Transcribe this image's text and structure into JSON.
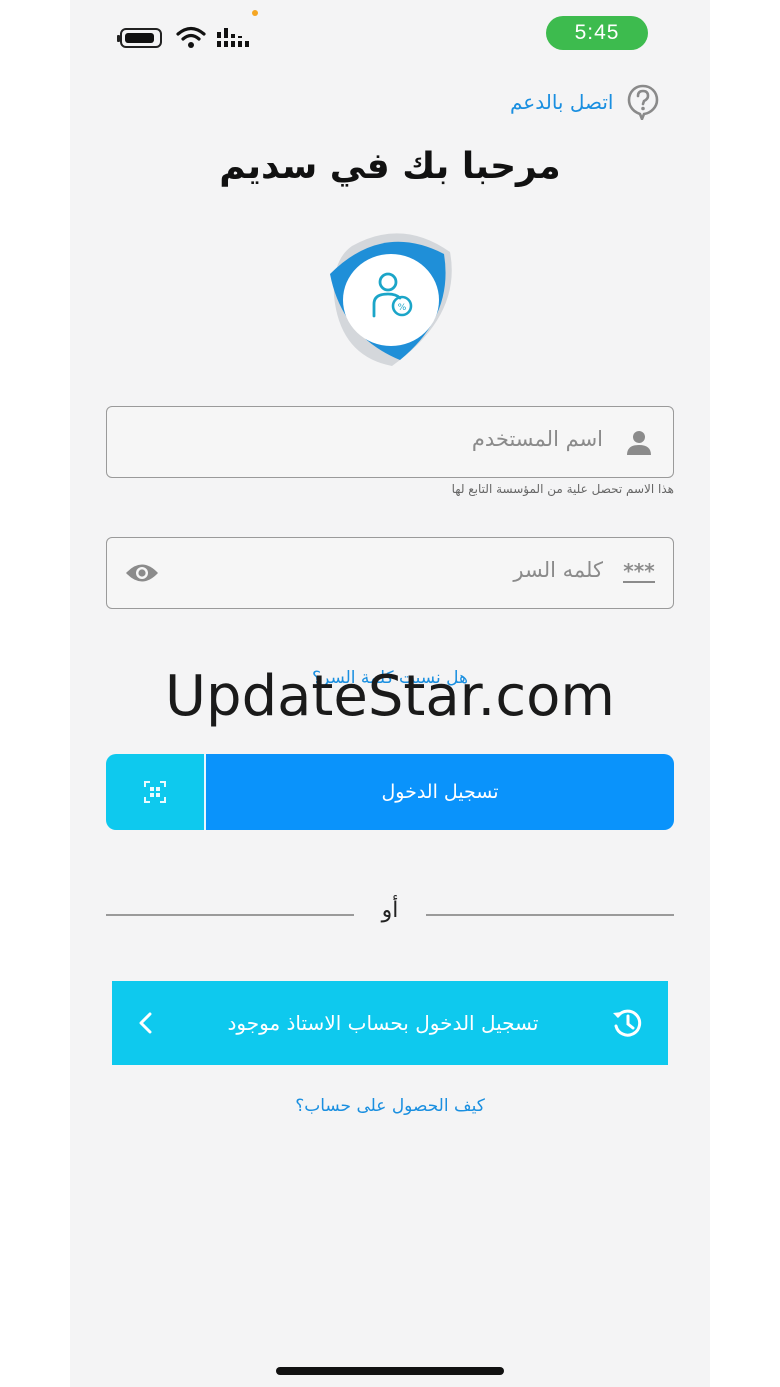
{
  "status_bar": {
    "time": "5:45",
    "time_color": "#3dbb4e"
  },
  "header": {
    "support_label": "اتصل بالدعم",
    "title": "مرحبا بك في سديم"
  },
  "form": {
    "username_placeholder": "اسم المستخدم",
    "username_helper": "هذا الاسم تحصل علية من المؤسسة التابع لها",
    "password_placeholder": "كلمه السر",
    "forgot_password": "هل نسيت كلمة السر؟",
    "login_label": "تسجيل الدخول"
  },
  "watermark": "UpdateStar.com",
  "alternate": {
    "or_label": "أو",
    "existing_account_label": "تسجيل الدخول بحساب الاستاذ موجود",
    "how_to_get_account": "كيف الحصول على حساب؟"
  },
  "colors": {
    "primary_blue": "#0a93fb",
    "cyan": "#0ec9ee",
    "link_blue": "#1a8fe0"
  }
}
